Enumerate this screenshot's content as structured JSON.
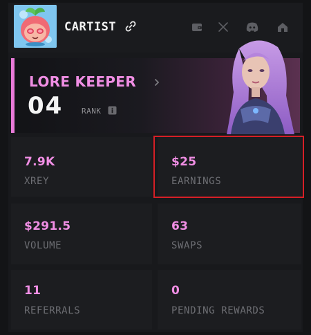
{
  "profile": {
    "username": "CARTIST",
    "icons": [
      "link-icon",
      "wallet-icon",
      "x-icon",
      "discord-icon",
      "home-icon"
    ]
  },
  "rank": {
    "title": "LORE KEEPER",
    "number": "04",
    "label": "RANK"
  },
  "stats": [
    {
      "value": "7.9K",
      "label": "XREY"
    },
    {
      "value": "$25",
      "label": "EARNINGS"
    },
    {
      "value": "$291.5",
      "label": "VOLUME"
    },
    {
      "value": "63",
      "label": "SWAPS"
    },
    {
      "value": "11",
      "label": "REFERRALS"
    },
    {
      "value": "0",
      "label": "PENDING REWARDS"
    }
  ],
  "colors": {
    "accent_pink": "#f08ee4",
    "background": "#131416",
    "card": "#1c1d20",
    "muted_text": "#6d6e73",
    "highlight": "#d61f26"
  }
}
